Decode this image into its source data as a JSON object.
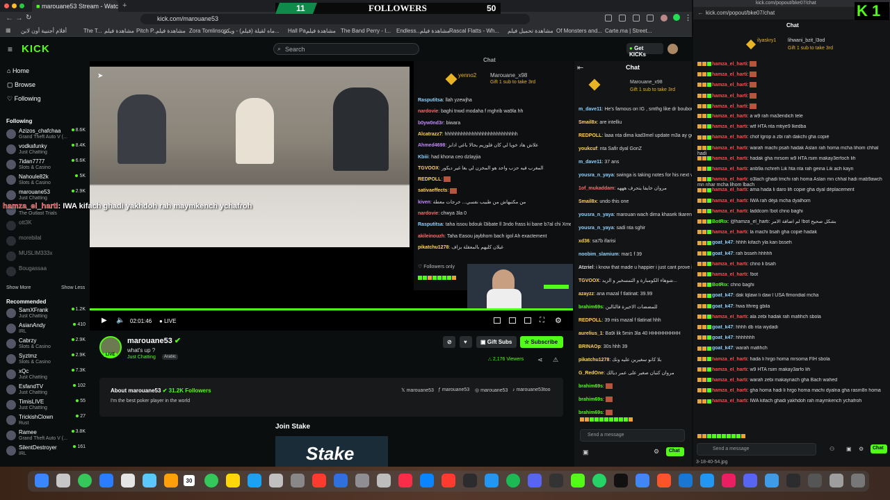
{
  "browser": {
    "tab_title": "marouane53 Stream - Watch L",
    "url": "kick.com/marouane53"
  },
  "bookmarks": [
    "أفلام أجنبية أون لاين",
    "The T...",
    "مشاهدة فيلم",
    "Pitch P...",
    "مشاهدة فيلم",
    "Zora Tomlinson",
    "ماه لقيلة (فيلم) - ويكي...",
    "Hall Pa...",
    "مشاهدة فيلم",
    "The Band Perry - I...",
    "Endless...",
    "مشاهدة فيلم",
    "Rascal Flatts - Wh...",
    "مشاهدة تحميل فيلم",
    "Of Monsters and...",
    "Carte.ma | Street..."
  ],
  "overlay": {
    "count_left": "11",
    "label": "FOLLOWERS",
    "count_right": "50",
    "k1": "K 1"
  },
  "header": {
    "logo": "KICK",
    "search_placeholder": "Search",
    "get_kicks": "Get KICKs"
  },
  "sidebar": {
    "nav": [
      "Home",
      "Browse",
      "Following"
    ],
    "following_title": "Following",
    "show_more": "Show More",
    "show_less": "Show Less",
    "recommended_title": "Recommended",
    "following": [
      {
        "name": "Azizos_chafchaa",
        "cat": "Grand Theft Auto V (...",
        "viewers": "8.6K"
      },
      {
        "name": "vodkafunky",
        "cat": "Just Chatting",
        "viewers": "8.4K"
      },
      {
        "name": "7idan7777",
        "cat": "Slots & Casino",
        "viewers": "6.6K"
      },
      {
        "name": "Nahoule82k",
        "cat": "Slots & Casino",
        "viewers": "5K"
      },
      {
        "name": "marouane53",
        "cat": "Just Chatting",
        "viewers": "2.9K"
      },
      {
        "name": "",
        "cat": "The Outlast Trials",
        "viewers": ""
      },
      {
        "name": "ott3K",
        "cat": "",
        "viewers": ""
      },
      {
        "name": "morebilal",
        "cat": "",
        "viewers": ""
      },
      {
        "name": "MUSLIM333x",
        "cat": "",
        "viewers": ""
      },
      {
        "name": "Bougassaa",
        "cat": "",
        "viewers": ""
      }
    ],
    "recommended": [
      {
        "name": "SamXFrank",
        "cat": "Just Chatting",
        "viewers": "1.2K"
      },
      {
        "name": "AsianAndy",
        "cat": "IRL",
        "viewers": "410"
      },
      {
        "name": "Cabrzy",
        "cat": "Slots & Casino",
        "viewers": "2.9K"
      },
      {
        "name": "Syztmz",
        "cat": "Slots & Casino",
        "viewers": "2.9K"
      },
      {
        "name": "xQc",
        "cat": "Just Chatting",
        "viewers": "7.3K"
      },
      {
        "name": "EsfandTV",
        "cat": "Just Chatting",
        "viewers": "102"
      },
      {
        "name": "TimisLIVE",
        "cat": "Just Chatting",
        "viewers": "55"
      },
      {
        "name": "TrickishClown",
        "cat": "Rust",
        "viewers": "27"
      },
      {
        "name": "Ramee",
        "cat": "Grand Theft Auto V (...",
        "viewers": "3.8K"
      },
      {
        "name": "SilentDestroyer",
        "cat": "IRL",
        "viewers": "161"
      }
    ]
  },
  "video": {
    "caption_user": "hamza_el_harti",
    "caption_text": ": IWA kifach ghadi yakhdoh rah maymkench ychafroh"
  },
  "overlay_chat": {
    "title": "Chat",
    "pin_user": "yenno2",
    "pin_user2": "Marouane_x98",
    "pin_text": "Gift 1 sub to take 3rd",
    "followers_only": "Followers only",
    "lines": [
      {
        "u": "Rasputitsa",
        "c": "#8fd3ff",
        "t": "llah yzewjha"
      },
      {
        "u": "nardovie",
        "c": "#ff6b6b",
        "t": "baghi tnwd modaha f mghrib wa9la hh"
      },
      {
        "u": "b0yw0nd3r",
        "c": "#c38aff",
        "t": "biwara"
      },
      {
        "u": "Alcatrazz7",
        "c": "#ffd35a",
        "t": "hhhhhhhhhhhhhhhhhhhhhhhhhhh"
      },
      {
        "u": "Ahmed4698",
        "c": "#c38aff",
        "t": "علاش هاد خويا لي كان فلوزيم بحالا باغي ادابز"
      },
      {
        "u": "Kbiii",
        "c": "#8fd3ff",
        "t": "had khona ceo dzlayjia"
      },
      {
        "u": "TGVOOX",
        "c": "#ffd35a",
        "t": "المغرب فيه حزب واحد هو المخزن لي بغا غير ديكور"
      },
      {
        "u": "REDPOLL",
        "c": "#ffd35a",
        "t": ""
      },
      {
        "u": "sativaeffects",
        "c": "#ffd35a",
        "t": ""
      },
      {
        "u": "kiven",
        "c": "#c38aff",
        "t": "من مكتبهاش من طبيب نفسي... خرجات معطة"
      },
      {
        "u": "nardovie",
        "c": "#ff6b6b",
        "t": "chwya 3la 0"
      },
      {
        "u": "Rasputitsa",
        "c": "#8fd3ff",
        "t": "taha issou bdouk l3ibate ll 3ndo frass ki bane b7al chi Xmen"
      },
      {
        "u": "akileinouzh",
        "c": "#ff6b6b",
        "t": "Taha Easou jaybhom bach igol Ah exactement"
      },
      {
        "u": "pikatchu1278",
        "c": "#ffd35a",
        "t": "غيلان كليهم بالمعقلة بزاف"
      }
    ]
  },
  "controls": {
    "time": "02:01:46",
    "live": "LIVE"
  },
  "channel": {
    "name": "marouane53",
    "title": "what's up ?",
    "category": "Just Chatting",
    "tag": "Arabic",
    "viewers": "2,176 Viewers",
    "gift_subs": "Gift Subs",
    "subscribe": "Subscribe",
    "live": "LIVE",
    "about_title": "About marouane53",
    "followers": "31.2K Followers",
    "bio": "I'm the best poker player in the world",
    "socials": [
      "marouane53",
      "marouane53",
      "marouane53",
      "marouane53too"
    ],
    "join_stake": "Join Stake",
    "stake_logo": "Stake"
  },
  "right_chat": {
    "title": "Chat",
    "pin_user": "Marouane_x98",
    "pin_text": "Gift 1 sub to take 3rd",
    "send_placeholder": "Send a message",
    "chat_button": "Chat",
    "lines": [
      {
        "u": "m_dave11",
        "c": "#8fd3ff",
        "t": "He's famous on IG , smthg like dr boubouh"
      },
      {
        "u": "Smail8x",
        "c": "#ffd35a",
        "t": "are intelliu"
      },
      {
        "u": "REDPOLL",
        "c": "#ffd35a",
        "t": "laaa nta dima kad3mel update m3a ay gen hhh"
      },
      {
        "u": "youkcuf",
        "c": "#ffd35a",
        "t": "nta Safir dyal GonZ"
      },
      {
        "u": "m_dave11",
        "c": "#8fd3ff",
        "t": "37 ans"
      },
      {
        "u": "yousra_n_yaya",
        "c": "#8fd3ff",
        "t": "swinga is taking notes for his next vd"
      },
      {
        "u": "1of_mukaddam",
        "c": "#ff6b6b",
        "t": "مروان خايفا يتحرف هههه"
      },
      {
        "u": "Smail8x",
        "c": "#ffd35a",
        "t": "undo this one"
      },
      {
        "u": "yousra_n_yaya",
        "c": "#8fd3ff",
        "t": "marouan wach dima khasek tkaren age hhhhhh"
      },
      {
        "u": "yousra_n_yaya",
        "c": "#8fd3ff",
        "t": "sadi nta sghir"
      },
      {
        "u": "xd36",
        "c": "#ffd35a",
        "t": "sa7b ifarisi"
      },
      {
        "u": "noobim_slamium",
        "c": "#8fd3ff",
        "t": "mar1 f 39"
      },
      {
        "u": "Atzriel",
        "c": "#ddd",
        "t": "i know that made u happier i just cant prove it"
      },
      {
        "u": "TGVOOX",
        "c": "#ffd35a",
        "t": "شوهاء الكومبارة و التمسخير و الزيد..."
      },
      {
        "u": "azayzz",
        "c": "#ffd35a",
        "t": "ana mazal f tlatinat: 39.99"
      },
      {
        "u": "brahim69s",
        "c": "#53fc18",
        "t": "للمضضات الاخيرة فالتالين"
      },
      {
        "u": "REDPOLL",
        "c": "#ffd35a",
        "t": "39 mis mazal f tlatinat hhh"
      },
      {
        "u": "aurelius_1",
        "c": "#ffd35a",
        "t": "Ba9i lik 5min 3la 40 HHHHHHHHH"
      },
      {
        "u": "BRINAOp",
        "c": "#ffd35a",
        "t": "30s hhh 39"
      },
      {
        "u": "pikatchu1278",
        "c": "#ffd35a",
        "t": "بلا كانو سغيرين عليه ونك"
      },
      {
        "u": "G_RedOne",
        "c": "#ffd35a",
        "t": "مروان كتبان صغير على عمر ديالك"
      },
      {
        "u": "brahim69s",
        "c": "#53fc18",
        "t": ""
      },
      {
        "u": "brahim69s",
        "c": "#53fc18",
        "t": ""
      },
      {
        "u": "brahim69s",
        "c": "#53fc18",
        "t": ""
      }
    ]
  },
  "popout": {
    "url": "kick.com/popout/bke07/chat",
    "window_title": "kick.com/popout/bke07/chat",
    "title": "Chat",
    "pin_user": "ilyaskry1",
    "pin_user2": "lihwani_bzit_l3od",
    "pin_text": "Gift 1 sub to take 3rd",
    "send_placeholder": "Send a message",
    "chat_button": "Chat",
    "k1": "K 1",
    "lines": [
      {
        "u": "hamza_el_harti",
        "c": "#ff4d4d",
        "t": ""
      },
      {
        "u": "hamza_el_harti",
        "c": "#ff4d4d",
        "t": ""
      },
      {
        "u": "hamza_el_harti",
        "c": "#ff4d4d",
        "t": ""
      },
      {
        "u": "hamza_el_harti",
        "c": "#ff4d4d",
        "t": ""
      },
      {
        "u": "hamza_el_harti",
        "c": "#ff4d4d",
        "t": ""
      },
      {
        "u": "hamza_el_harti",
        "c": "#ff4d4d",
        "t": "a w9 rah ma3endich tele"
      },
      {
        "u": "hamza_el_harti",
        "c": "#ff4d4d",
        "t": "wtf HTA nta mtiye9 lkedba"
      },
      {
        "u": "hamza_el_harti",
        "c": "#ff4d4d",
        "t": "chof lgrop a zbi rah dakchi gha copié"
      },
      {
        "u": "hamza_el_harti",
        "c": "#ff4d4d",
        "t": "warah machi psah hadak Aslan rah homa mcha lihom chhal hadi"
      },
      {
        "u": "hamza_el_harti",
        "c": "#ff4d4d",
        "t": "hadak gha mrsom w9 HTA rsim makay3erfoch lih"
      },
      {
        "u": "hamza_el_harti",
        "c": "#ff4d4d",
        "t": "anb9a nchreh Lik hta nta rah geina Lik ach kayn"
      },
      {
        "u": "hamza_el_harti",
        "c": "#ff4d4d",
        "t": "o3lach ghadi tmchi rah homa Aslan mn chhal hadi mab9awch mn nhar mcha lihom lbach"
      },
      {
        "u": "hamza_el_harti",
        "c": "#ff4d4d",
        "t": "ama hada li daro lih copie gha dyal déplacement"
      },
      {
        "u": "hamza_el_harti",
        "c": "#ff4d4d",
        "t": "IWA rah déjà mcha dyalhom"
      },
      {
        "u": "hamza_el_harti",
        "c": "#ff4d4d",
        "t": "laddcom !bot chno baghi"
      },
      {
        "u": "BotRix",
        "c": "#53fc18",
        "t": "@hamza_el_harti: لم اضافة الامر !bot بشكل صحيح"
      },
      {
        "u": "hamza_el_harti",
        "c": "#ff4d4d",
        "t": "la machi bsah gha copié hadak"
      },
      {
        "u": "goat_k47",
        "c": "#8fd3ff",
        "t": "hhhh kifach yla kan bsseh"
      },
      {
        "u": "goat_k47",
        "c": "#8fd3ff",
        "t": "rah bsseh hhhhh"
      },
      {
        "u": "hamza_el_harti",
        "c": "#ff4d4d",
        "t": "chno li bsah"
      },
      {
        "u": "hamza_el_harti",
        "c": "#ff4d4d",
        "t": "!bot"
      },
      {
        "u": "BotRix",
        "c": "#53fc18",
        "t": "chno baghi"
      },
      {
        "u": "goat_k47",
        "c": "#8fd3ff",
        "t": "dak lqlawi li daw l USA flmondial mcha"
      },
      {
        "u": "goat_k47",
        "c": "#8fd3ff",
        "t": "hwa lthreg gbila"
      },
      {
        "u": "hamza_el_harti",
        "c": "#ff4d4d",
        "t": "ala zebi hadak rah mafihch sbola"
      },
      {
        "u": "goat_k47",
        "c": "#8fd3ff",
        "t": "hhhh db nta wydadi"
      },
      {
        "u": "goat_k47",
        "c": "#8fd3ff",
        "t": "hhhhhhh"
      },
      {
        "u": "goat_k47",
        "c": "#8fd3ff",
        "t": "warah mafihch"
      },
      {
        "u": "hamza_el_harti",
        "c": "#ff4d4d",
        "t": "hada li hrgo homa mrsoma FIH sbola"
      },
      {
        "u": "hamza_el_harti",
        "c": "#ff4d4d",
        "t": "w9 HTA rsim makay3arfo lih"
      },
      {
        "u": "hamza_el_harti",
        "c": "#ff4d4d",
        "t": "warah zebi makaynach gha Bach wahed"
      },
      {
        "u": "hamza_el_harti",
        "c": "#ff4d4d",
        "t": "gha homa hadi li hrgo homa machi dyalna gha rasm8n homa"
      },
      {
        "u": "hamza_el_harti",
        "c": "#ff4d4d",
        "t": "IWA kifach ghadi yakhdoh rah maymkench ychafroh"
      }
    ]
  },
  "dock": {
    "calendar_day": "30",
    "file_label": "3-18-40-54.jpg"
  }
}
